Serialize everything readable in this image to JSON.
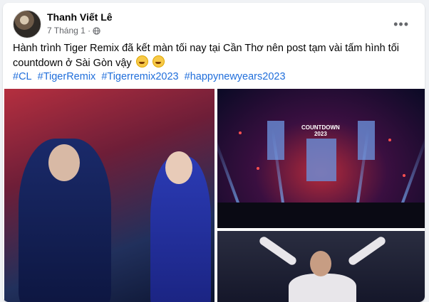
{
  "post": {
    "author": "Thanh Viết Lê",
    "date": "7 Tháng 1 ·",
    "more_label": "•••",
    "body": "Hành trình Tiger Remix đã kết màn tối nay tại Cần Thơ nên post tạm vài tấm hình tối countdown ở Sài Gòn vậy",
    "hashtags": [
      "#CL",
      "#TigerRemix",
      "#Tigerremix2023",
      "#happynewyears2023"
    ]
  },
  "photos": {
    "countdown_title": "COUNTDOWN",
    "countdown_year": "2023"
  },
  "icons": {
    "privacy": "globe-icon",
    "more": "more-horizontal-icon",
    "emoji": "grinning-face-icon"
  },
  "colors": {
    "link": "#216fdb",
    "meta": "#65676b",
    "text": "#050505"
  }
}
